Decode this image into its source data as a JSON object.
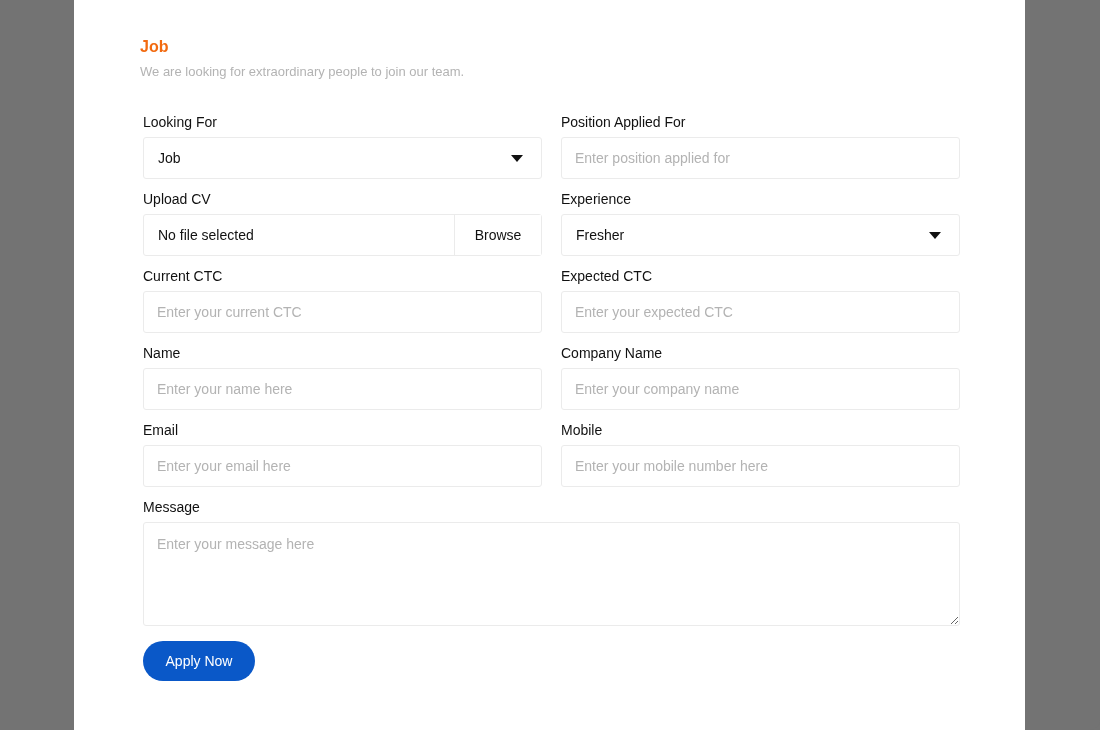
{
  "form": {
    "title": "Job",
    "subtitle": "We are looking for extraordinary people to join our team.",
    "fields": [
      {
        "kind": "select",
        "label": "Looking For",
        "value": "Job"
      },
      {
        "kind": "text",
        "label": "Position Applied For",
        "placeholder": "Enter position applied for"
      },
      {
        "kind": "file",
        "label": "Upload CV",
        "value": "No file selected",
        "button": "Browse"
      },
      {
        "kind": "select",
        "label": "Experience",
        "value": "Fresher"
      },
      {
        "kind": "text",
        "label": "Current CTC",
        "placeholder": "Enter your current CTC"
      },
      {
        "kind": "text",
        "label": "Expected CTC",
        "placeholder": "Enter your expected CTC"
      },
      {
        "kind": "text",
        "label": "Name",
        "placeholder": "Enter your name here"
      },
      {
        "kind": "text",
        "label": "Company Name",
        "placeholder": "Enter your company name"
      },
      {
        "kind": "text",
        "label": "Email",
        "placeholder": "Enter your email here"
      },
      {
        "kind": "text",
        "label": "Mobile",
        "placeholder": "Enter your mobile number here"
      },
      {
        "kind": "textarea",
        "label": "Message",
        "placeholder": "Enter your message here"
      }
    ],
    "submit": "Apply Now"
  }
}
